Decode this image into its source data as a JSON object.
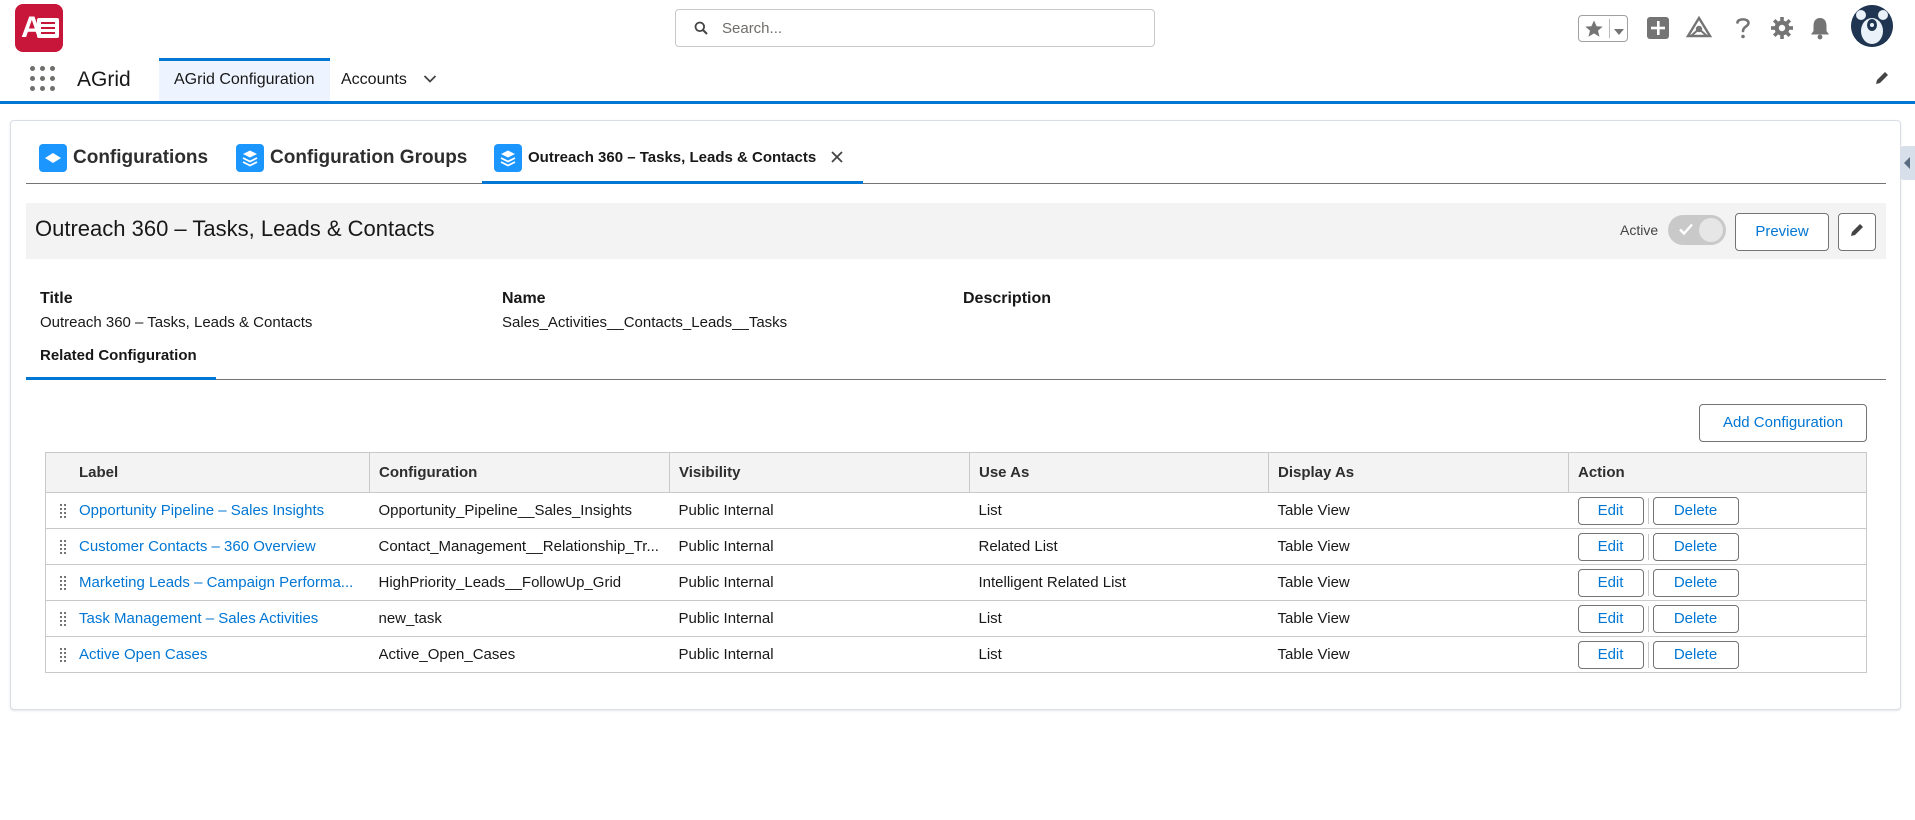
{
  "header": {
    "search_placeholder": "Search...",
    "icons": [
      "favorites-star-icon",
      "add-icon",
      "trailhead-icon",
      "help-icon",
      "setup-gear-icon",
      "notifications-bell-icon"
    ]
  },
  "nav": {
    "app_name": "AGrid",
    "tabs": [
      {
        "label": "AGrid Configuration",
        "active": true
      },
      {
        "label": "Accounts",
        "active": false
      }
    ]
  },
  "content_tabs": [
    {
      "label": "Configurations",
      "icon": "layers-icon"
    },
    {
      "label": "Configuration Groups",
      "icon": "stack-icon"
    },
    {
      "label": "Outreach 360 – Tasks, Leads & Contacts",
      "icon": "stack-icon",
      "active": true
    }
  ],
  "record": {
    "title": "Outreach 360 – Tasks, Leads & Contacts",
    "active_label": "Active",
    "preview_label": "Preview",
    "fields": {
      "title_label": "Title",
      "title_value": "Outreach 360 – Tasks, Leads & Contacts",
      "name_label": "Name",
      "name_value": "Sales_Activities__Contacts_Leads__Tasks",
      "description_label": "Description"
    }
  },
  "related": {
    "tab_label": "Related Configuration",
    "add_label": "Add Configuration",
    "columns": [
      "Label",
      "Configuration",
      "Visibility",
      "Use As",
      "Display As",
      "Action"
    ],
    "rows": [
      {
        "label": "Opportunity Pipeline – Sales Insights",
        "configuration": "Opportunity_Pipeline__Sales_Insights",
        "visibility": "Public Internal",
        "use_as": "List",
        "display_as": "Table View"
      },
      {
        "label": "Customer Contacts – 360 Overview",
        "configuration": "Contact_Management__Relationship_Tr...",
        "visibility": "Public Internal",
        "use_as": "Related List",
        "display_as": "Table View"
      },
      {
        "label": "Marketing Leads – Campaign Performa...",
        "configuration": "HighPriority_Leads__FollowUp_Grid",
        "visibility": "Public Internal",
        "use_as": "Intelligent Related List",
        "display_as": "Table View"
      },
      {
        "label": "Task Management – Sales Activities",
        "configuration": "new_task",
        "visibility": "Public Internal",
        "use_as": "List",
        "display_as": "Table View"
      },
      {
        "label": "Active Open Cases",
        "configuration": "Active_Open_Cases",
        "visibility": "Public Internal",
        "use_as": "List",
        "display_as": "Table View"
      }
    ],
    "edit_label": "Edit",
    "delete_label": "Delete"
  },
  "colors": {
    "brand": "#0176d3",
    "tab_icon": "#1b96ff",
    "logo": "#c8163b"
  }
}
